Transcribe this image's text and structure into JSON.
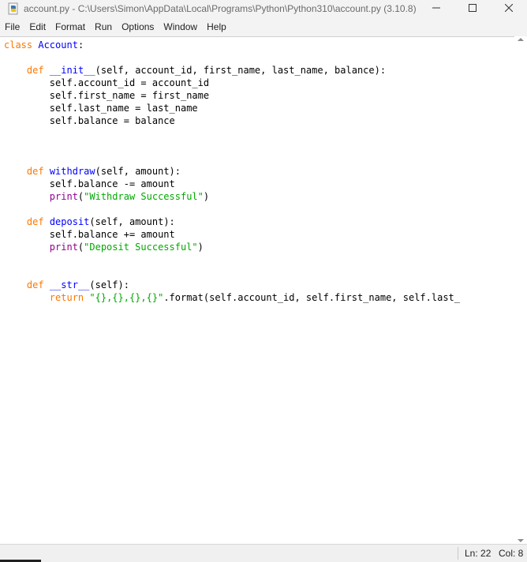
{
  "window": {
    "title": "account.py - C:\\Users\\Simon\\AppData\\Local\\Programs\\Python\\Python310\\account.py (3.10.8)",
    "controls": [
      "minimize-icon",
      "maximize-icon",
      "close-icon"
    ]
  },
  "menu": {
    "items": [
      "File",
      "Edit",
      "Format",
      "Run",
      "Options",
      "Window",
      "Help"
    ]
  },
  "syntax_colors": {
    "keyword": "#ff7700",
    "definition": "#0000ff",
    "builtin": "#900090",
    "string": "#00aa00",
    "default": "#000000"
  },
  "code": {
    "lines": [
      [
        [
          "kw",
          "class"
        ],
        [
          "",
          " "
        ],
        [
          "def",
          "Account"
        ],
        [
          "",
          ":"
        ]
      ],
      [],
      [
        [
          "",
          "    "
        ],
        [
          "kw",
          "def"
        ],
        [
          "",
          " "
        ],
        [
          "def",
          "__init__"
        ],
        [
          "",
          "(self, account_id, first_name, last_name, balance):"
        ]
      ],
      [
        [
          "",
          "        self.account_id = account_id"
        ]
      ],
      [
        [
          "",
          "        self.first_name = first_name"
        ]
      ],
      [
        [
          "",
          "        self.last_name = last_name"
        ]
      ],
      [
        [
          "",
          "        self.balance = balance"
        ]
      ],
      [],
      [],
      [],
      [
        [
          "",
          "    "
        ],
        [
          "kw",
          "def"
        ],
        [
          "",
          " "
        ],
        [
          "def",
          "withdraw"
        ],
        [
          "",
          "(self, amount):"
        ]
      ],
      [
        [
          "",
          "        self.balance -= amount"
        ]
      ],
      [
        [
          "",
          "        "
        ],
        [
          "builtin",
          "print"
        ],
        [
          "",
          "("
        ],
        [
          "str",
          "\"Withdraw Successful\""
        ],
        [
          "",
          ")"
        ]
      ],
      [],
      [
        [
          "",
          "    "
        ],
        [
          "kw",
          "def"
        ],
        [
          "",
          " "
        ],
        [
          "def",
          "deposit"
        ],
        [
          "",
          "(self, amount):"
        ]
      ],
      [
        [
          "",
          "        self.balance += amount"
        ]
      ],
      [
        [
          "",
          "        "
        ],
        [
          "builtin",
          "print"
        ],
        [
          "",
          "("
        ],
        [
          "str",
          "\"Deposit Successful\""
        ],
        [
          "",
          ")"
        ]
      ],
      [],
      [],
      [
        [
          "",
          "    "
        ],
        [
          "kw",
          "def"
        ],
        [
          "",
          " "
        ],
        [
          "def",
          "__str__"
        ],
        [
          "",
          "(self):"
        ]
      ],
      [
        [
          "",
          "        "
        ],
        [
          "kw",
          "return"
        ],
        [
          "",
          " "
        ],
        [
          "str",
          "\"{},{},{},{}\""
        ],
        [
          "",
          ".format(self.account_id, self.first_name, self.last_"
        ]
      ]
    ]
  },
  "status": {
    "ln": "Ln: 22",
    "col": "Col: 8"
  }
}
